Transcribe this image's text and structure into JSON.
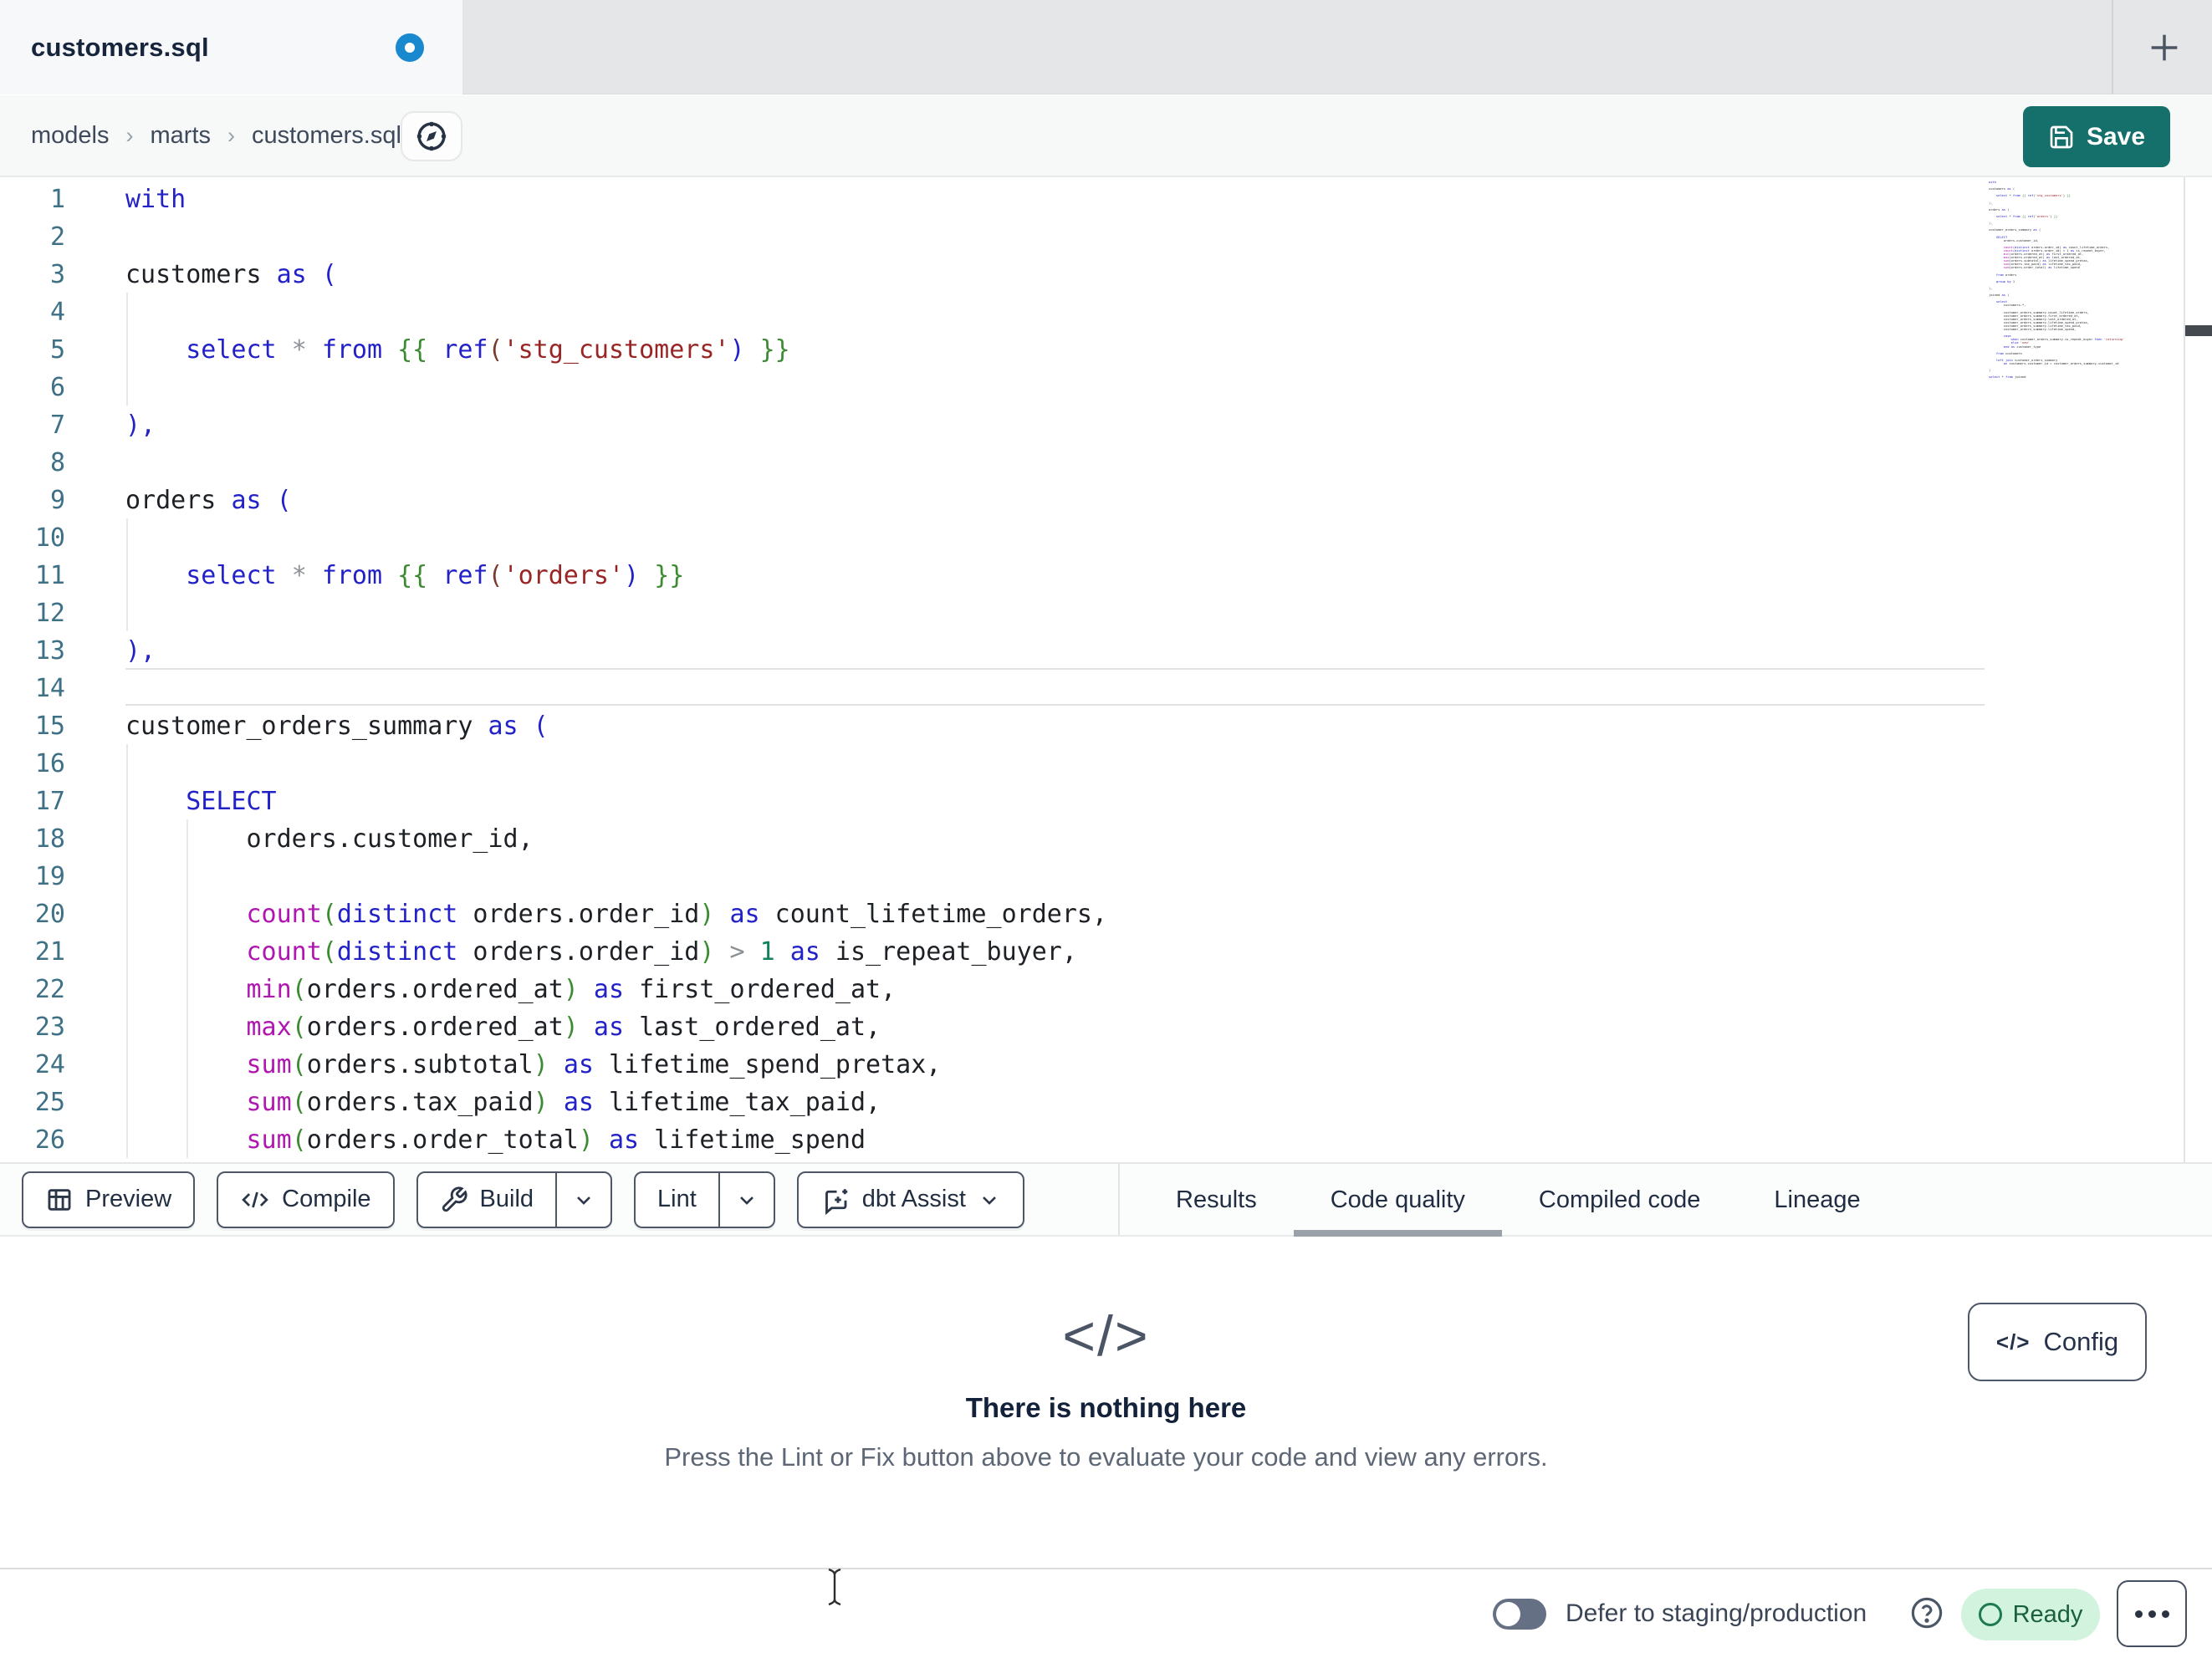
{
  "window": {
    "tab_title": "customers.sql",
    "new_tab_label": "+"
  },
  "breadcrumb": {
    "items": [
      "models",
      "marts",
      "customers.sql"
    ],
    "separator": "›"
  },
  "save_button": {
    "label": "Save"
  },
  "toolbar": {
    "preview_label": "Preview",
    "compile_label": "Compile",
    "build_label": "Build",
    "lint_label": "Lint",
    "dbt_assist_label": "dbt Assist"
  },
  "panel_tabs": [
    {
      "label": "Results",
      "active": false
    },
    {
      "label": "Code quality",
      "active": true
    },
    {
      "label": "Compiled code",
      "active": false
    },
    {
      "label": "Lineage",
      "active": false
    }
  ],
  "empty_state": {
    "icon": "</>",
    "title": "There is nothing here",
    "subtitle": "Press the Lint or Fix button above to evaluate your code and view any errors."
  },
  "config_button": {
    "label": "Config",
    "icon": "</>"
  },
  "status_bar": {
    "defer_label": "Defer to staging/production",
    "ready_label": "Ready"
  },
  "colors": {
    "accent_teal": "#15706b",
    "unsaved_dot_blue": "#1888cf",
    "ready_badge_bg": "#d2f3dd",
    "ready_badge_text": "#195f40",
    "keyword_blue": "#2222c8",
    "function_magenta": "#b017b0",
    "string_red": "#992525",
    "jinja_green": "#3c8a31",
    "number_teal": "#12805c",
    "line_number_teal": "#3e7086",
    "active_tab_underline": "#9aa1a8"
  },
  "editor": {
    "lines": [
      {
        "n": 1,
        "tokens": [
          [
            "k",
            "with"
          ]
        ]
      },
      {
        "n": 2,
        "tokens": []
      },
      {
        "n": 3,
        "tokens": [
          [
            "p",
            "customers "
          ],
          [
            "k",
            "as"
          ],
          [
            "p",
            " "
          ],
          [
            "k",
            "("
          ]
        ]
      },
      {
        "n": 4,
        "tokens": []
      },
      {
        "n": 5,
        "tokens": [
          [
            "p",
            "    "
          ],
          [
            "k",
            "select"
          ],
          [
            "p",
            " "
          ],
          [
            "o",
            "*"
          ],
          [
            "p",
            " "
          ],
          [
            "k",
            "from"
          ],
          [
            "p",
            " "
          ],
          [
            "g",
            "{{"
          ],
          [
            "p",
            " "
          ],
          [
            "k",
            "ref"
          ],
          [
            "b",
            "("
          ],
          [
            "s",
            "'stg_customers'"
          ],
          [
            "k",
            ")"
          ],
          [
            "p",
            " "
          ],
          [
            "g",
            "}}"
          ]
        ]
      },
      {
        "n": 6,
        "tokens": []
      },
      {
        "n": 7,
        "tokens": [
          [
            "k",
            "),"
          ]
        ]
      },
      {
        "n": 8,
        "tokens": []
      },
      {
        "n": 9,
        "tokens": [
          [
            "p",
            "orders "
          ],
          [
            "k",
            "as"
          ],
          [
            "p",
            " "
          ],
          [
            "k",
            "("
          ]
        ]
      },
      {
        "n": 10,
        "tokens": []
      },
      {
        "n": 11,
        "tokens": [
          [
            "p",
            "    "
          ],
          [
            "k",
            "select"
          ],
          [
            "p",
            " "
          ],
          [
            "o",
            "*"
          ],
          [
            "p",
            " "
          ],
          [
            "k",
            "from"
          ],
          [
            "p",
            " "
          ],
          [
            "g",
            "{{"
          ],
          [
            "p",
            " "
          ],
          [
            "k",
            "ref"
          ],
          [
            "b",
            "("
          ],
          [
            "s",
            "'orders'"
          ],
          [
            "k",
            ")"
          ],
          [
            "p",
            " "
          ],
          [
            "g",
            "}}"
          ]
        ]
      },
      {
        "n": 12,
        "tokens": []
      },
      {
        "n": 13,
        "tokens": [
          [
            "k",
            "),"
          ]
        ]
      },
      {
        "n": 14,
        "tokens": []
      },
      {
        "n": 15,
        "tokens": [
          [
            "p",
            "customer_orders_summary "
          ],
          [
            "k",
            "as"
          ],
          [
            "p",
            " "
          ],
          [
            "k",
            "("
          ]
        ]
      },
      {
        "n": 16,
        "tokens": []
      },
      {
        "n": 17,
        "tokens": [
          [
            "p",
            "    "
          ],
          [
            "k",
            "SELECT"
          ]
        ]
      },
      {
        "n": 18,
        "tokens": [
          [
            "p",
            "        orders.customer_id,"
          ]
        ]
      },
      {
        "n": 19,
        "tokens": []
      },
      {
        "n": 20,
        "tokens": [
          [
            "p",
            "        "
          ],
          [
            "f",
            "count"
          ],
          [
            "g",
            "("
          ],
          [
            "k",
            "distinct"
          ],
          [
            "p",
            " orders.order_id"
          ],
          [
            "g",
            ")"
          ],
          [
            "p",
            " "
          ],
          [
            "k",
            "as"
          ],
          [
            "p",
            " count_lifetime_orders,"
          ]
        ]
      },
      {
        "n": 21,
        "tokens": [
          [
            "p",
            "        "
          ],
          [
            "f",
            "count"
          ],
          [
            "g",
            "("
          ],
          [
            "k",
            "distinct"
          ],
          [
            "p",
            " orders.order_id"
          ],
          [
            "g",
            ")"
          ],
          [
            "p",
            " "
          ],
          [
            "o",
            ">"
          ],
          [
            "p",
            " "
          ],
          [
            "n",
            "1"
          ],
          [
            "p",
            " "
          ],
          [
            "k",
            "as"
          ],
          [
            "p",
            " is_repeat_buyer,"
          ]
        ]
      },
      {
        "n": 22,
        "tokens": [
          [
            "p",
            "        "
          ],
          [
            "f",
            "min"
          ],
          [
            "g",
            "("
          ],
          [
            "p",
            "orders.ordered_at"
          ],
          [
            "g",
            ")"
          ],
          [
            "p",
            " "
          ],
          [
            "k",
            "as"
          ],
          [
            "p",
            " first_ordered_at,"
          ]
        ]
      },
      {
        "n": 23,
        "tokens": [
          [
            "p",
            "        "
          ],
          [
            "f",
            "max"
          ],
          [
            "g",
            "("
          ],
          [
            "p",
            "orders.ordered_at"
          ],
          [
            "g",
            ")"
          ],
          [
            "p",
            " "
          ],
          [
            "k",
            "as"
          ],
          [
            "p",
            " last_ordered_at,"
          ]
        ]
      },
      {
        "n": 24,
        "tokens": [
          [
            "p",
            "        "
          ],
          [
            "f",
            "sum"
          ],
          [
            "g",
            "("
          ],
          [
            "p",
            "orders.subtotal"
          ],
          [
            "g",
            ")"
          ],
          [
            "p",
            " "
          ],
          [
            "k",
            "as"
          ],
          [
            "p",
            " lifetime_spend_pretax,"
          ]
        ]
      },
      {
        "n": 25,
        "tokens": [
          [
            "p",
            "        "
          ],
          [
            "f",
            "sum"
          ],
          [
            "g",
            "("
          ],
          [
            "p",
            "orders.tax_paid"
          ],
          [
            "g",
            ")"
          ],
          [
            "p",
            " "
          ],
          [
            "k",
            "as"
          ],
          [
            "p",
            " lifetime_tax_paid,"
          ]
        ]
      },
      {
        "n": 26,
        "tokens": [
          [
            "p",
            "        "
          ],
          [
            "f",
            "sum"
          ],
          [
            "g",
            "("
          ],
          [
            "p",
            "orders.order_total"
          ],
          [
            "g",
            ")"
          ],
          [
            "p",
            " "
          ],
          [
            "k",
            "as"
          ],
          [
            "p",
            " lifetime_spend"
          ]
        ]
      }
    ],
    "minimap_lines": [
      "with",
      "",
      "customers as (",
      "",
      "    select * from {{ ref('stg_customers') }}",
      "",
      "),",
      "",
      "orders as (",
      "",
      "    select * from {{ ref('orders') }}",
      "",
      "),",
      "",
      "customer_orders_summary as (",
      "",
      "    SELECT",
      "        orders.customer_id,",
      "",
      "        count(distinct orders.order_id) as count_lifetime_orders,",
      "        count(distinct orders.order_id) > 1 as is_repeat_buyer,",
      "        min(orders.ordered_at) as first_ordered_at,",
      "        max(orders.ordered_at) as last_ordered_at,",
      "        sum(orders.subtotal) as lifetime_spend_pretax,",
      "        sum(orders.tax_paid) as lifetime_tax_paid,",
      "        sum(orders.order_total) as lifetime_spend",
      "",
      "    from orders",
      "",
      "    group by 1",
      "",
      "),",
      "",
      "joined as (",
      "",
      "    select",
      "        customers.*,",
      "",
      "        customer_orders_summary.count_lifetime_orders,",
      "        customer_orders_summary.first_ordered_at,",
      "        customer_orders_summary.last_ordered_at,",
      "        customer_orders_summary.lifetime_spend_pretax,",
      "        customer_orders_summary.lifetime_tax_paid,",
      "        customer_orders_summary.lifetime_spend,",
      "",
      "        case",
      "            when customer_orders_summary.is_repeat_buyer then 'returning'",
      "            else 'new'",
      "        end as customer_type",
      "",
      "    from customers",
      "",
      "    left join customer_orders_summary",
      "        on customers.customer_id = customer_orders_summary.customer_id",
      "",
      ")",
      "",
      "select * from joined"
    ]
  }
}
